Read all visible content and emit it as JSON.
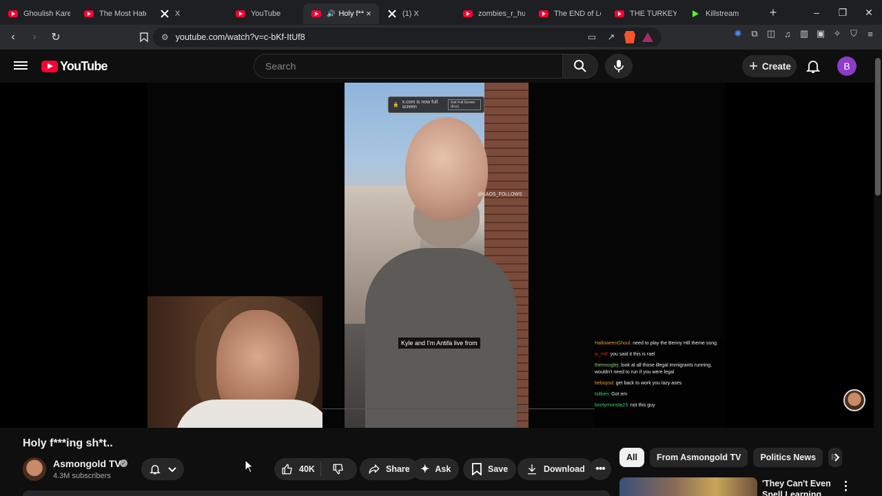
{
  "browser": {
    "tabs": [
      {
        "title": "Ghoulish Karen",
        "icon": "youtube-icon",
        "active": false
      },
      {
        "title": "The Most Hated",
        "icon": "youtube-icon",
        "active": false
      },
      {
        "title": "X",
        "icon": "x-icon",
        "active": false
      },
      {
        "title": "YouTube",
        "icon": "youtube-icon",
        "active": false
      },
      {
        "title": "Holy f**",
        "icon": "youtube-icon",
        "active": true
      },
      {
        "title": "(1) X",
        "icon": "x-icon",
        "active": false
      },
      {
        "title": "zombies_r_hung",
        "icon": "youtube-icon",
        "active": false
      },
      {
        "title": "The END of Lol",
        "icon": "youtube-icon",
        "active": false
      },
      {
        "title": "THE TURKEY TO",
        "icon": "youtube-icon",
        "active": false
      },
      {
        "title": "Killstream",
        "icon": "kick-icon",
        "active": false
      }
    ],
    "url": "youtube.com/watch?v=c-bKf-ItUf8"
  },
  "masthead": {
    "logo_text": "YouTube",
    "search_placeholder": "Search",
    "create_label": "Create",
    "avatar_letter": "B"
  },
  "player": {
    "fullscreen_notice": "x.com is now full screen",
    "fullscreen_exit": "Exit Full Screen (Esc)",
    "watermark": "@KAOS_FOLLOWS",
    "caption": "Kyle and I'm Antifa live from",
    "chat": [
      {
        "user": "HalloweenGhoul:",
        "text": "need to play the Benny Hill theme song."
      },
      {
        "user": "iy_m0:",
        "text": "you said it this is rael"
      },
      {
        "user": "themooglej:",
        "text": "look at all those illegal immigrants running, wouldn't need to run if you were legal"
      },
      {
        "user": "bebopsd:",
        "text": "get back to work you lazy ases"
      },
      {
        "user": "tsitken:",
        "text": "Got em"
      },
      {
        "user": "bootymonsta23:",
        "text": "not this guy"
      }
    ]
  },
  "video": {
    "title": "Holy f***ing sh*t..",
    "channel": "Asmongold TV",
    "subscribers": "4.3M subscribers",
    "likes": "40K",
    "actions": {
      "share": "Share",
      "ask": "Ask",
      "save": "Save",
      "download": "Download"
    }
  },
  "sidebar": {
    "chips": [
      "All",
      "From Asmongold TV",
      "Politics News",
      "R"
    ],
    "recommendation_title": "'They Can't Even Spell Learning"
  },
  "colors": {
    "yt_red": "#ff0033",
    "bg": "#0f0f0f",
    "pill": "#272727",
    "avatar": "#8e3bc9"
  }
}
